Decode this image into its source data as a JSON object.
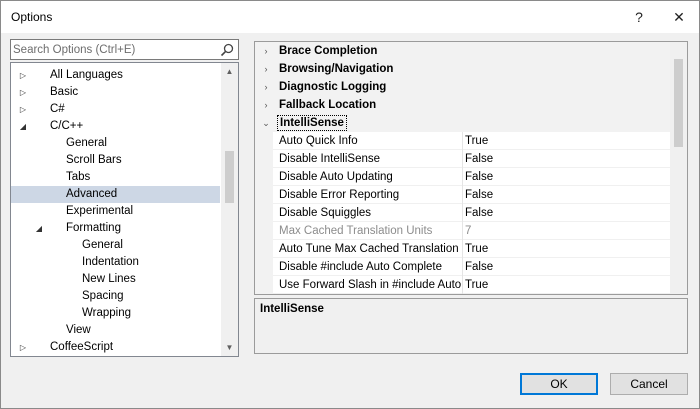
{
  "window": {
    "title": "Options",
    "help_glyph": "?",
    "close_glyph": "✕"
  },
  "search": {
    "placeholder": "Search Options (Ctrl+E)",
    "icon": "search-icon"
  },
  "tree": {
    "items": [
      {
        "label": "All Languages",
        "level": 1,
        "state": "collapsed"
      },
      {
        "label": "Basic",
        "level": 1,
        "state": "collapsed"
      },
      {
        "label": "C#",
        "level": 1,
        "state": "collapsed"
      },
      {
        "label": "C/C++",
        "level": 1,
        "state": "expanded"
      },
      {
        "label": "General",
        "level": 2,
        "state": "leaf"
      },
      {
        "label": "Scroll Bars",
        "level": 2,
        "state": "leaf"
      },
      {
        "label": "Tabs",
        "level": 2,
        "state": "leaf"
      },
      {
        "label": "Advanced",
        "level": 2,
        "state": "leaf",
        "selected": true
      },
      {
        "label": "Experimental",
        "level": 2,
        "state": "leaf"
      },
      {
        "label": "Formatting",
        "level": 2,
        "state": "expanded"
      },
      {
        "label": "General",
        "level": 3,
        "state": "leaf"
      },
      {
        "label": "Indentation",
        "level": 3,
        "state": "leaf"
      },
      {
        "label": "New Lines",
        "level": 3,
        "state": "leaf"
      },
      {
        "label": "Spacing",
        "level": 3,
        "state": "leaf"
      },
      {
        "label": "Wrapping",
        "level": 3,
        "state": "leaf"
      },
      {
        "label": "View",
        "level": 2,
        "state": "leaf"
      },
      {
        "label": "CoffeeScript",
        "level": 1,
        "state": "collapsed"
      }
    ]
  },
  "grid": {
    "categories": [
      {
        "label": "Brace Completion",
        "expanded": false
      },
      {
        "label": "Browsing/Navigation",
        "expanded": false
      },
      {
        "label": "Diagnostic Logging",
        "expanded": false
      },
      {
        "label": "Fallback Location",
        "expanded": false
      },
      {
        "label": "IntelliSense",
        "expanded": true
      }
    ],
    "properties": [
      {
        "name": "Auto Quick Info",
        "value": "True"
      },
      {
        "name": "Disable IntelliSense",
        "value": "False"
      },
      {
        "name": "Disable Auto Updating",
        "value": "False"
      },
      {
        "name": "Disable Error Reporting",
        "value": "False"
      },
      {
        "name": "Disable Squiggles",
        "value": "False"
      },
      {
        "name": "Max Cached Translation Units",
        "value": "7",
        "disabled": true
      },
      {
        "name": "Auto Tune Max Cached Translation Units",
        "value": "True"
      },
      {
        "name": "Disable #include Auto Complete",
        "value": "False"
      },
      {
        "name": "Use Forward Slash in #include Auto Complete",
        "value": "True"
      }
    ]
  },
  "description": {
    "title": "IntelliSense"
  },
  "buttons": {
    "ok": "OK",
    "cancel": "Cancel"
  }
}
